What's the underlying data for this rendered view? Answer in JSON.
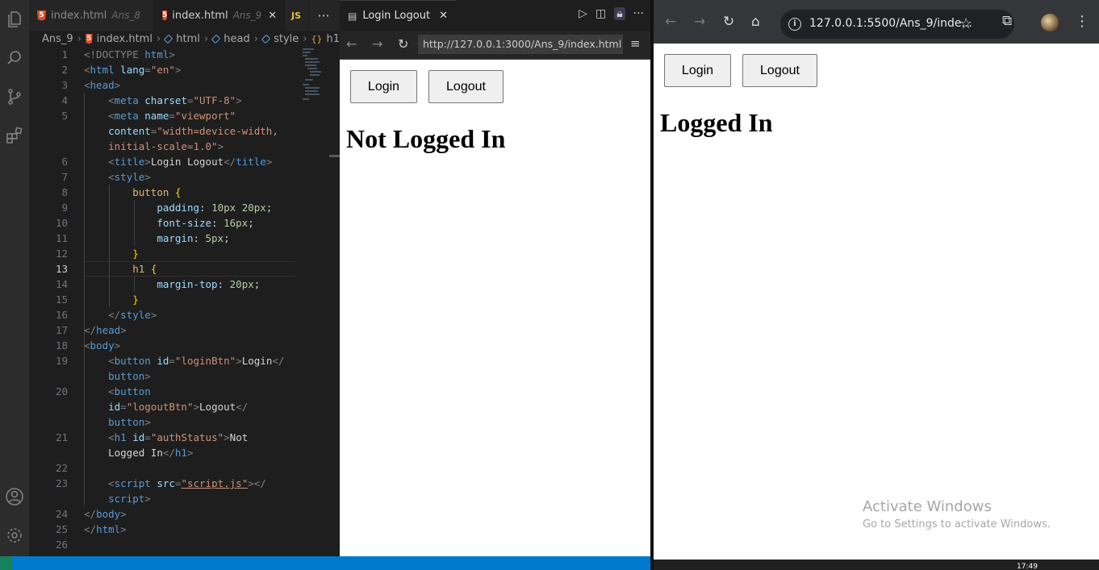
{
  "vscode": {
    "tabs": [
      {
        "name": "index.html",
        "folder": "Ans_8",
        "active": false
      },
      {
        "name": "index.html",
        "folder": "Ans_9",
        "active": true
      },
      {
        "name": "JS",
        "folder": "",
        "active": false
      }
    ],
    "tab_more": "···",
    "breadcrumb": [
      "Ans_9",
      "index.html",
      "html",
      "head",
      "style",
      "h1"
    ],
    "current_line": 13,
    "line_numbers": [
      "1",
      "2",
      "3",
      "4",
      "5",
      "",
      "",
      "6",
      "7",
      "8",
      "9",
      "10",
      "11",
      "12",
      "13",
      "14",
      "15",
      "16",
      "17",
      "18",
      "19",
      "",
      "20",
      "",
      "",
      "21",
      "",
      "22",
      "23",
      "",
      "24",
      "25",
      "26"
    ],
    "code": {
      "doctype_open": "<!DOCTYPE ",
      "doctype_html": "html",
      "doctype_close": ">",
      "lang_attr": "lang",
      "lang_val": "\"en\"",
      "charset_attr": "charset",
      "charset_val": "\"UTF-8\"",
      "name_attr": "name",
      "viewport_val": "\"viewport\"",
      "content_attr": "content",
      "content_val_1": "\"width=device-width,",
      "content_val_2": "initial-scale=1.0\"",
      "title_text": "Login Logout",
      "sel_button": "button",
      "prop_padding": "padding",
      "val_padding": "10px 20px",
      "prop_font": "font-size",
      "val_font": "16px",
      "prop_margin": "margin",
      "val_margin": "5px",
      "sel_h1": "h1",
      "prop_margintop": "margin-top",
      "val_margintop": "20px",
      "id_attr": "id",
      "login_id": "\"loginBtn\"",
      "login_text": "Login",
      "logout_id": "\"logoutBtn\"",
      "logout_text": "Logout",
      "auth_id": "\"authStatus\"",
      "auth_text_1": "Not",
      "auth_text_2": "Logged In",
      "src_attr": "src",
      "src_val": "\"script.js\""
    }
  },
  "simple_browser": {
    "tab_title": "Login Logout",
    "url": "http://127.0.0.1:3000/Ans_9/index.html",
    "page": {
      "login_label": "Login",
      "logout_label": "Logout",
      "status": "Not Logged In"
    }
  },
  "chrome": {
    "url": "127.0.0.1:5500/Ans_9/inde...",
    "page": {
      "login_label": "Login",
      "logout_label": "Logout",
      "status": "Logged In"
    }
  },
  "watermark": {
    "line1": "Activate Windows",
    "line2": "Go to Settings to activate Windows."
  },
  "taskbar": {
    "time": "17:49"
  },
  "colors": {
    "vscode_status": "#007acc",
    "chrome_toolbar": "#35363a",
    "editor_bg": "#1e1e1e"
  }
}
